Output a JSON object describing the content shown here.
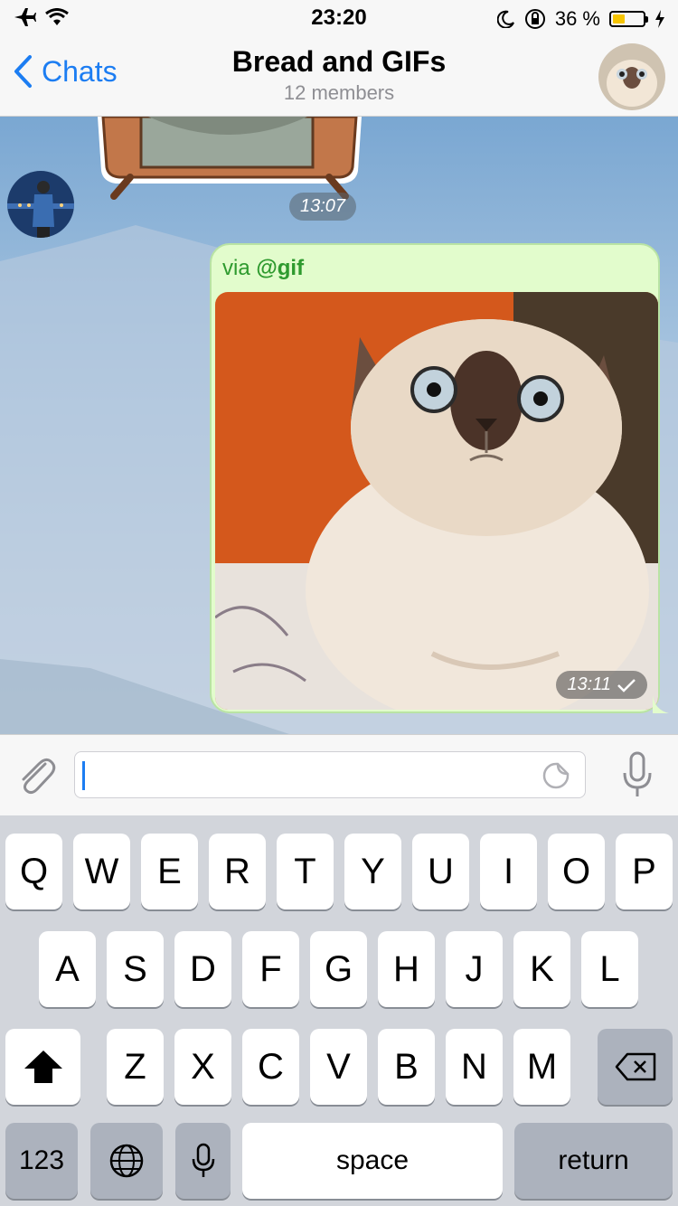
{
  "status_bar": {
    "time": "23:20",
    "battery_percent": "36 %",
    "battery_level": 0.36
  },
  "nav": {
    "back_label": "Chats",
    "title": "Bread and GIFs",
    "subtitle": "12 members"
  },
  "chat": {
    "sticker_time": "13:07",
    "message": {
      "via_prefix": "via ",
      "via_bot": "@gif",
      "time": "13:11"
    }
  },
  "input": {
    "text": ""
  },
  "keyboard": {
    "row1": [
      "Q",
      "W",
      "E",
      "R",
      "T",
      "Y",
      "U",
      "I",
      "O",
      "P"
    ],
    "row2": [
      "A",
      "S",
      "D",
      "F",
      "G",
      "H",
      "J",
      "K",
      "L"
    ],
    "row3": [
      "Z",
      "X",
      "C",
      "V",
      "B",
      "N",
      "M"
    ],
    "numbers_label": "123",
    "space_label": "space",
    "return_label": "return"
  },
  "colors": {
    "accent": "#1c7df2",
    "bubble": "#e2fccc",
    "via_text": "#2e9a2e"
  }
}
